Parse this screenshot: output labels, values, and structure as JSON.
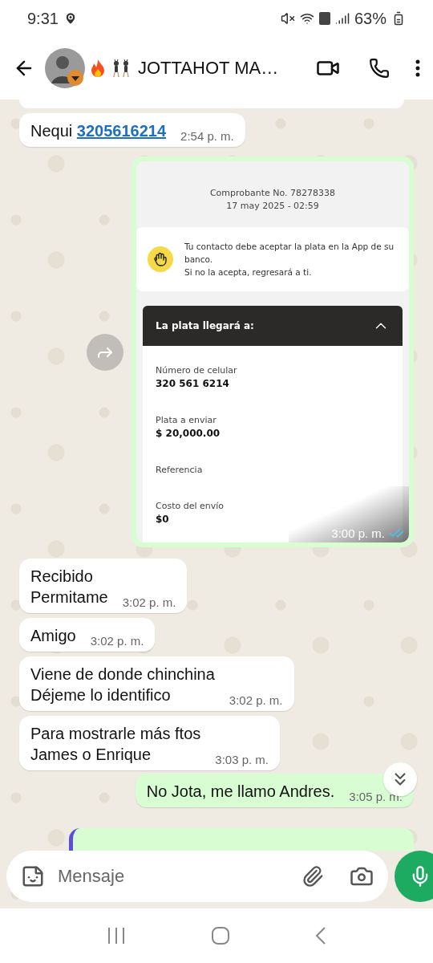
{
  "status_bar": {
    "time": "9:31",
    "battery": "63%"
  },
  "chat_header": {
    "title": "JOTTAHOT MA…"
  },
  "messages": [
    {
      "kind": "partial",
      "outgoing": false
    },
    {
      "kind": "text",
      "outgoing": false,
      "lines": [
        "Nequi"
      ],
      "link": "3205616214",
      "time": "2:54 p. m."
    },
    {
      "kind": "receipt",
      "outgoing": true,
      "comprobante": "Comprobante No. 78278338",
      "date": "17 may 2025 - 02:59",
      "notice": [
        "Tu contacto debe aceptar la plata en la App de su banco.",
        "Si no la acepta, regresará a ti."
      ],
      "recipient_header": "La plata llegará a:",
      "expanded": true,
      "fields": [
        {
          "label": "Número de celular",
          "value": "320 561 6214"
        },
        {
          "label": "Plata a enviar",
          "value": "$ 20,000.00"
        },
        {
          "label": "Referencia"
        },
        {
          "label": "Costo del envío",
          "value": "$0"
        }
      ],
      "time": "3:00 p. m.",
      "read": true
    },
    {
      "kind": "text",
      "outgoing": false,
      "lines": [
        "Recibido",
        "Permitame"
      ],
      "time": "3:02 p. m."
    },
    {
      "kind": "text",
      "outgoing": false,
      "lines": [
        "Amigo"
      ],
      "time": "3:02 p. m."
    },
    {
      "kind": "text",
      "outgoing": false,
      "lines": [
        "Viene de donde chinchina",
        "Déjeme lo identifico"
      ],
      "time": "3:02 p. m."
    },
    {
      "kind": "text",
      "outgoing": false,
      "lines": [
        "Para mostrarle más ftos",
        "James o Enrique"
      ],
      "time": "3:03 p. m."
    },
    {
      "kind": "text",
      "outgoing": true,
      "lines": [
        "No Jota, me llamo Andres."
      ],
      "time": "3:05 p. m."
    },
    {
      "kind": "partial",
      "outgoing": true
    }
  ],
  "composer": {
    "placeholder": "Mensaje"
  }
}
